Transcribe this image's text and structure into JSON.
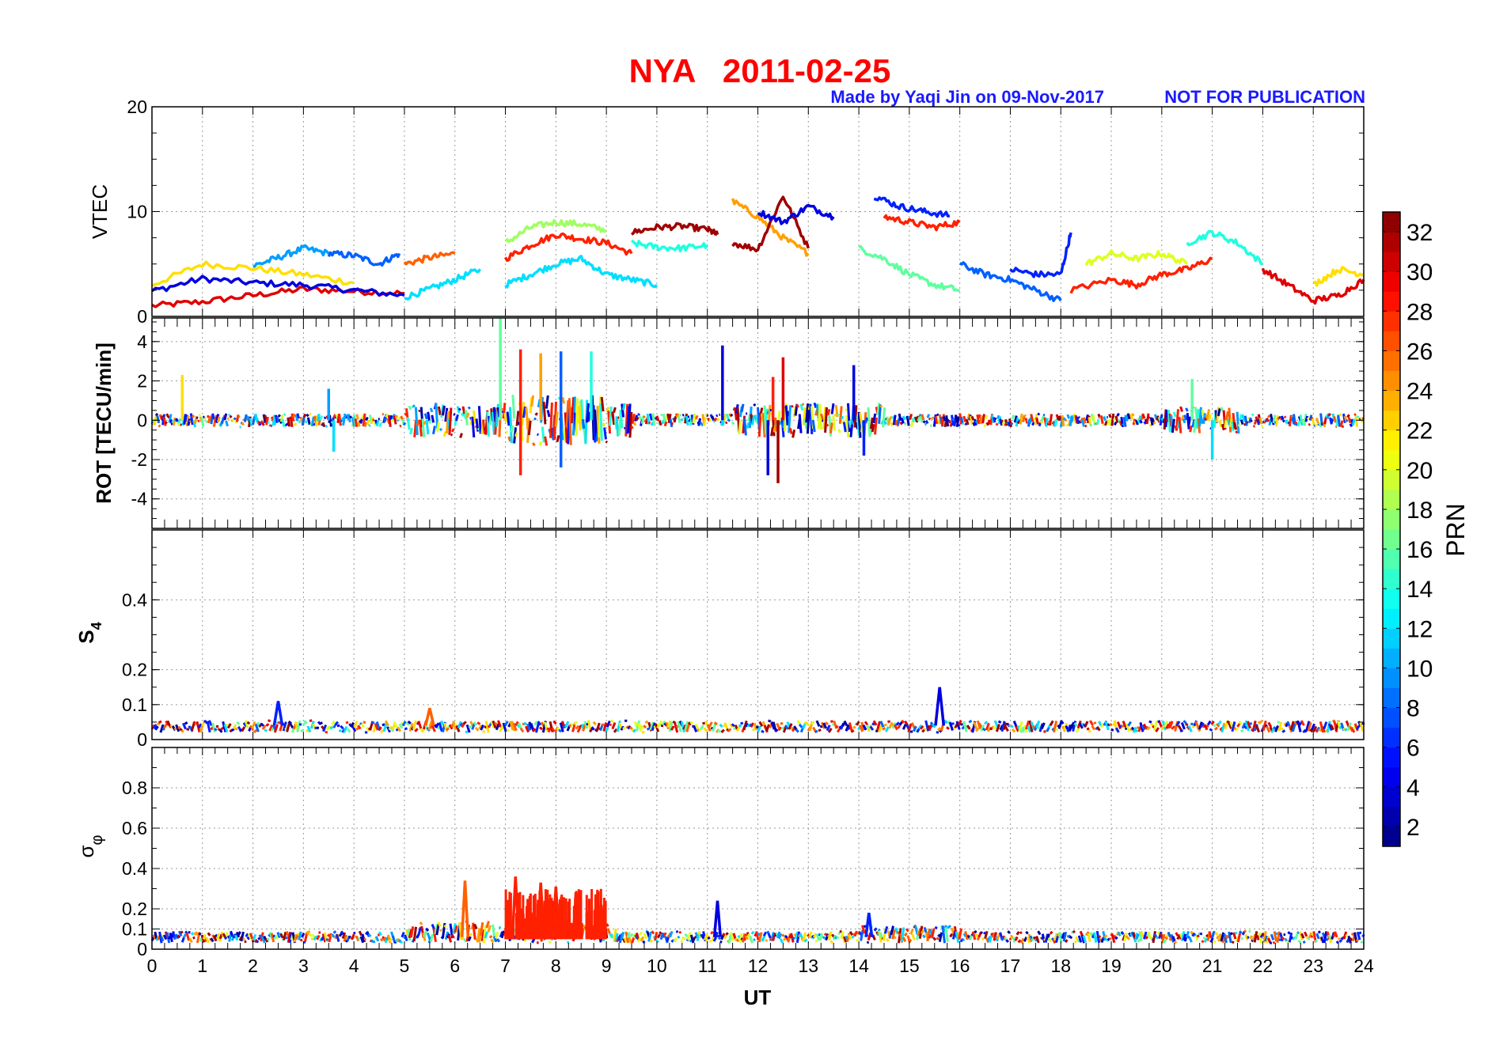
{
  "figure": {
    "title": "NYA   2011-02-25",
    "credit": "Made by Yaqi Jin on 09-Nov-2017",
    "notice": "NOT FOR PUBLICATION",
    "xlabel": "UT",
    "colorbar_label": "PRN",
    "colors": {
      "title": "#ff0000",
      "credit": "#1a1aff"
    }
  },
  "chart_data": [
    {
      "type": "line",
      "panel": "vtec",
      "ylabel": "VTEC",
      "xlim": [
        0,
        24
      ],
      "ylim": [
        0,
        20
      ],
      "yticks": [
        0,
        10,
        20
      ],
      "xticks": [
        0,
        1,
        2,
        3,
        4,
        5,
        6,
        7,
        8,
        9,
        10,
        11,
        12,
        13,
        14,
        15,
        16,
        17,
        18,
        19,
        20,
        21,
        22,
        23,
        24
      ],
      "grid": true,
      "series": [
        {
          "prn": 30,
          "x": [
            0,
            1,
            2,
            3,
            4,
            5
          ],
          "y": [
            1.0,
            1.4,
            2.0,
            2.6,
            2.4,
            2.2
          ]
        },
        {
          "prn": 4,
          "x": [
            0,
            1,
            2,
            3,
            4,
            5
          ],
          "y": [
            2.4,
            3.6,
            3.2,
            3.0,
            2.5,
            2.0
          ]
        },
        {
          "prn": 22,
          "x": [
            0,
            1,
            2,
            3,
            4
          ],
          "y": [
            3.0,
            5.0,
            4.6,
            4.0,
            3.2
          ]
        },
        {
          "prn": 10,
          "x": [
            2,
            2.5,
            3,
            3.5
          ],
          "y": [
            4.8,
            5.6,
            6.5,
            6.0
          ]
        },
        {
          "prn": 8,
          "x": [
            3.5,
            4,
            4.5,
            4.9
          ],
          "y": [
            6.0,
            5.8,
            5.0,
            6.0
          ]
        },
        {
          "prn": 26,
          "x": [
            5,
            5.5,
            6
          ],
          "y": [
            5.0,
            5.6,
            6.0
          ]
        },
        {
          "prn": 12,
          "x": [
            5,
            5.5,
            6,
            6.5
          ],
          "y": [
            1.8,
            2.6,
            3.5,
            4.5
          ]
        },
        {
          "prn": 28,
          "x": [
            7,
            7.5,
            8,
            8.5,
            9,
            9.5
          ],
          "y": [
            5.5,
            6.8,
            7.8,
            7.4,
            7.0,
            6.0
          ]
        },
        {
          "prn": 18,
          "x": [
            7,
            7.5,
            8,
            8.5,
            9
          ],
          "y": [
            7.0,
            8.5,
            9.0,
            8.8,
            8.2
          ]
        },
        {
          "prn": 12,
          "x": [
            7,
            7.5,
            8,
            8.5,
            9,
            9.5,
            10
          ],
          "y": [
            3.0,
            4.0,
            5.0,
            5.5,
            4.0,
            3.5,
            3.0
          ]
        },
        {
          "prn": 32,
          "x": [
            9.5,
            10,
            10.5,
            11,
            11.2
          ],
          "y": [
            8.0,
            8.5,
            8.6,
            8.3,
            7.8
          ]
        },
        {
          "prn": 14,
          "x": [
            9.5,
            10,
            10.5,
            11
          ],
          "y": [
            7.0,
            6.6,
            6.5,
            6.8
          ]
        },
        {
          "prn": 24,
          "x": [
            11.5,
            12,
            12.5,
            13
          ],
          "y": [
            11.0,
            9.5,
            7.5,
            6.0
          ]
        },
        {
          "prn": 32,
          "x": [
            11.5,
            12,
            12.5,
            13
          ],
          "y": [
            7.0,
            6.4,
            11.5,
            6.5
          ]
        },
        {
          "prn": 4,
          "x": [
            12,
            12.5,
            13,
            13.5
          ],
          "y": [
            10.0,
            9.0,
            10.5,
            9.5
          ]
        },
        {
          "prn": 6,
          "x": [
            14.3,
            14.8,
            15.3,
            15.8
          ],
          "y": [
            11.5,
            10.5,
            10.0,
            9.6
          ]
        },
        {
          "prn": 28,
          "x": [
            14.5,
            15,
            15.5,
            16
          ],
          "y": [
            9.5,
            9.0,
            8.5,
            9.0
          ]
        },
        {
          "prn": 16,
          "x": [
            14,
            14.5,
            15,
            15.5,
            16
          ],
          "y": [
            6.5,
            5.5,
            4.0,
            3.0,
            2.5
          ]
        },
        {
          "prn": 8,
          "x": [
            16,
            16.5,
            17,
            17.5,
            18
          ],
          "y": [
            5.0,
            4.0,
            3.5,
            2.5,
            1.5
          ]
        },
        {
          "prn": 6,
          "x": [
            17,
            17.5,
            18,
            18.2
          ],
          "y": [
            4.5,
            4.0,
            4.0,
            8.0
          ]
        },
        {
          "prn": 28,
          "x": [
            18.2,
            19,
            19.5,
            20,
            20.5,
            21
          ],
          "y": [
            2.5,
            3.5,
            3.0,
            4.0,
            4.5,
            5.5
          ]
        },
        {
          "prn": 20,
          "x": [
            18.5,
            19,
            19.5,
            20,
            20.5
          ],
          "y": [
            5.0,
            6.0,
            5.5,
            6.0,
            5.0
          ]
        },
        {
          "prn": 14,
          "x": [
            20.5,
            21,
            21.5,
            22
          ],
          "y": [
            7.0,
            8.0,
            7.0,
            5.0
          ]
        },
        {
          "prn": 30,
          "x": [
            22,
            22.5,
            23,
            23.5,
            24
          ],
          "y": [
            4.5,
            3.0,
            1.5,
            2.0,
            3.5
          ]
        },
        {
          "prn": 22,
          "x": [
            23,
            23.5,
            24
          ],
          "y": [
            3.0,
            4.5,
            4.0
          ]
        }
      ]
    },
    {
      "type": "line",
      "panel": "rot",
      "ylabel": "ROT [TECU/min]",
      "xlim": [
        0,
        24
      ],
      "ylim": [
        -5.5,
        5.2
      ],
      "yticks": [
        -4,
        -2,
        0,
        2,
        4
      ],
      "grid": true,
      "spikes": [
        {
          "x": 0.6,
          "y": 2.3,
          "prn": 22
        },
        {
          "x": 3.5,
          "y": 1.6,
          "prn": 10
        },
        {
          "x": 3.6,
          "y": -1.6,
          "prn": 12
        },
        {
          "x": 6.9,
          "y": 5.2,
          "prn": 16
        },
        {
          "x": 7.3,
          "y": 3.6,
          "prn": 28
        },
        {
          "x": 7.3,
          "y": -2.8,
          "prn": 28
        },
        {
          "x": 7.7,
          "y": 3.4,
          "prn": 24
        },
        {
          "x": 8.1,
          "y": 3.5,
          "prn": 8
        },
        {
          "x": 8.1,
          "y": -2.4,
          "prn": 8
        },
        {
          "x": 8.7,
          "y": 3.5,
          "prn": 14
        },
        {
          "x": 11.3,
          "y": 3.8,
          "prn": 4
        },
        {
          "x": 12.3,
          "y": 2.2,
          "prn": 28
        },
        {
          "x": 12.5,
          "y": 3.2,
          "prn": 30
        },
        {
          "x": 12.4,
          "y": -3.2,
          "prn": 32
        },
        {
          "x": 12.2,
          "y": -2.8,
          "prn": 4
        },
        {
          "x": 13.9,
          "y": 2.8,
          "prn": 4
        },
        {
          "x": 14.1,
          "y": -1.8,
          "prn": 6
        },
        {
          "x": 20.6,
          "y": 2.1,
          "prn": 16
        },
        {
          "x": 21.0,
          "y": -2.0,
          "prn": 12
        }
      ]
    },
    {
      "type": "line",
      "panel": "s4",
      "ylabel": "S4",
      "xlim": [
        0,
        24
      ],
      "ylim": [
        0,
        0.6
      ],
      "yticks": [
        0,
        0.1,
        0.2,
        0.4
      ],
      "grid": true,
      "peaks": [
        {
          "x": 2.5,
          "y": 0.11,
          "prn": 6
        },
        {
          "x": 5.5,
          "y": 0.09,
          "prn": 26
        },
        {
          "x": 15.6,
          "y": 0.15,
          "prn": 4
        }
      ]
    },
    {
      "type": "line",
      "panel": "sigma_phi",
      "ylabel": "σφ",
      "xlim": [
        0,
        24
      ],
      "ylim": [
        0,
        1.0
      ],
      "yticks": [
        0,
        0.1,
        0.2,
        0.4,
        0.6,
        0.8
      ],
      "grid": true,
      "peaks": [
        {
          "x": 6.2,
          "y": 0.34,
          "prn": 26
        },
        {
          "x": 7.2,
          "y": 0.36,
          "prn": 28
        },
        {
          "x": 7.7,
          "y": 0.33,
          "prn": 28
        },
        {
          "x": 8.0,
          "y": 0.31,
          "prn": 28
        },
        {
          "x": 8.4,
          "y": 0.28,
          "prn": 28
        },
        {
          "x": 8.9,
          "y": 0.22,
          "prn": 28
        },
        {
          "x": 11.2,
          "y": 0.24,
          "prn": 4
        },
        {
          "x": 14.2,
          "y": 0.18,
          "prn": 6
        }
      ]
    },
    {
      "type": "heatmap",
      "panel": "colorbar",
      "label": "PRN",
      "range": [
        1,
        33
      ],
      "ticks": [
        2,
        4,
        6,
        8,
        10,
        12,
        14,
        16,
        18,
        20,
        22,
        24,
        26,
        28,
        30,
        32
      ],
      "colormap": "jet"
    }
  ]
}
